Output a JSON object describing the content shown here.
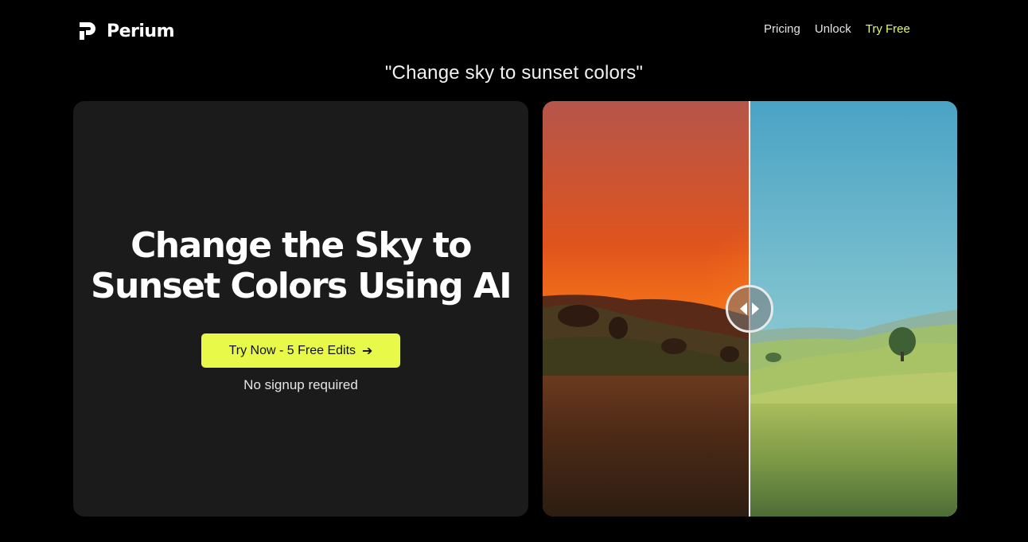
{
  "header": {
    "brand": "Perium",
    "nav": [
      {
        "label": "Pricing"
      },
      {
        "label": "Unlock"
      },
      {
        "label": "Try Free"
      }
    ]
  },
  "prompt": "\"Change sky to sunset colors\"",
  "hero": {
    "title_line1": "Change the Sky to",
    "title_line2": "Sunset Colors Using AI",
    "cta_label": "Try Now - 5 Free Edits",
    "cta_arrow": "➔",
    "note": "No signup required"
  },
  "comparison": {
    "slider_position": 0.5,
    "before_label": "",
    "after_label": ""
  },
  "colors": {
    "background": "#000000",
    "card": "#1b1b1b",
    "accent": "#e8f949",
    "nav_cta": "#e5f76b",
    "sunset_top": "#b85a4a",
    "sunset_glow": "#ff7a10",
    "sky_top": "#4fa6c6",
    "sky_bottom": "#b6dcd3"
  },
  "icons": {
    "logo": "perium-logo-icon",
    "slider_handle": "compare-handle-icon"
  }
}
